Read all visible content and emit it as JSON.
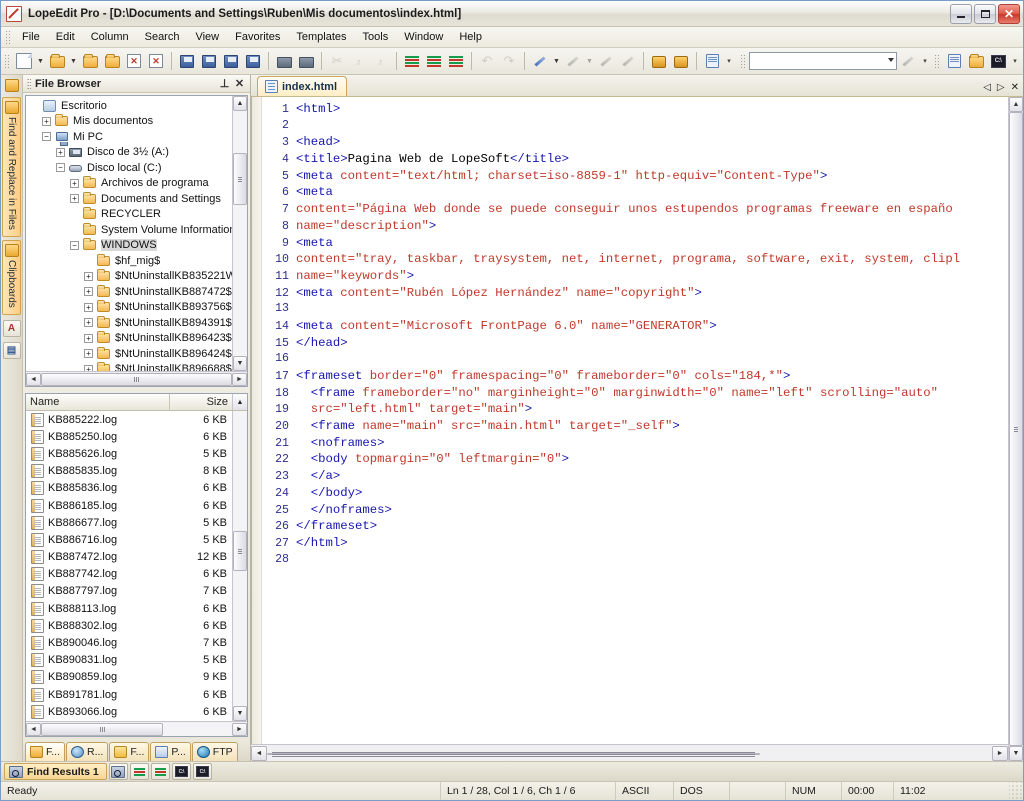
{
  "window": {
    "title": "LopeEdit Pro - [D:\\Documents and Settings\\Ruben\\Mis documentos\\index.html]",
    "minimize_label": "_",
    "maximize_label": "□",
    "close_label": "✕"
  },
  "menu": {
    "items": [
      "File",
      "Edit",
      "Column",
      "Search",
      "View",
      "Favorites",
      "Templates",
      "Tools",
      "Window",
      "Help"
    ]
  },
  "toolbar": {
    "search_value": "",
    "search_placeholder": "",
    "buttons": [
      "new-file",
      "new-file-dropdown",
      "open-file",
      "open-file-dropdown",
      "open-recent",
      "close-file",
      "close-all",
      "close-window",
      "save",
      "save-as",
      "save-all",
      "save-to-ftp",
      "print",
      "print-preview",
      "cut",
      "copy",
      "paste",
      "compare",
      "indent",
      "outdent",
      "undo",
      "redo",
      "highlight",
      "highlight-dropdown",
      "bookmark-toggle",
      "bookmark-next",
      "bookmark-clear",
      "macro-record",
      "macro-play",
      "run-external",
      "go-to",
      "favorites-folder",
      "console"
    ]
  },
  "rail": {
    "tabs": [
      {
        "label": "Find and Replace in Files",
        "icon": "folder-search-icon"
      },
      {
        "label": "Clipboards",
        "icon": "clipboard-icon"
      }
    ],
    "buttons": [
      "ascii-table-icon",
      "document-icon"
    ]
  },
  "file_browser": {
    "title": "File Browser",
    "pin_label": "⊥",
    "close_label": "✕",
    "tree": [
      {
        "label": "Escritorio",
        "indent": 0,
        "expander": "",
        "icon": "desktop-icon"
      },
      {
        "label": "Mis documentos",
        "indent": 1,
        "expander": "+",
        "icon": "folder-icon"
      },
      {
        "label": "Mi PC",
        "indent": 1,
        "expander": "−",
        "icon": "computer-icon"
      },
      {
        "label": "Disco de 3½ (A:)",
        "indent": 2,
        "expander": "+",
        "icon": "floppy-icon"
      },
      {
        "label": "Disco local (C:)",
        "indent": 2,
        "expander": "−",
        "icon": "harddisk-icon"
      },
      {
        "label": "Archivos de programa",
        "indent": 3,
        "expander": "+",
        "icon": "folder-icon"
      },
      {
        "label": "Documents and Settings",
        "indent": 3,
        "expander": "+",
        "icon": "folder-icon"
      },
      {
        "label": "RECYCLER",
        "indent": 3,
        "expander": "",
        "icon": "folder-icon"
      },
      {
        "label": "System Volume Information",
        "indent": 3,
        "expander": "",
        "icon": "folder-icon"
      },
      {
        "label": "WINDOWS",
        "indent": 3,
        "expander": "−",
        "icon": "folder-icon",
        "selected": true
      },
      {
        "label": "$hf_mig$",
        "indent": 4,
        "expander": "",
        "icon": "folder-icon"
      },
      {
        "label": "$NtUninstallKB835221W",
        "indent": 4,
        "expander": "+",
        "icon": "folder-icon"
      },
      {
        "label": "$NtUninstallKB887472$",
        "indent": 4,
        "expander": "+",
        "icon": "folder-icon"
      },
      {
        "label": "$NtUninstallKB893756$",
        "indent": 4,
        "expander": "+",
        "icon": "folder-icon"
      },
      {
        "label": "$NtUninstallKB894391$",
        "indent": 4,
        "expander": "+",
        "icon": "folder-icon"
      },
      {
        "label": "$NtUninstallKB896423$",
        "indent": 4,
        "expander": "+",
        "icon": "folder-icon"
      },
      {
        "label": "$NtUninstallKB896424$",
        "indent": 4,
        "expander": "+",
        "icon": "folder-icon"
      },
      {
        "label": "$NtUninstallKB896688$",
        "indent": 4,
        "expander": "+",
        "icon": "folder-icon"
      }
    ],
    "list_headers": {
      "name": "Name",
      "size": "Size"
    },
    "files": [
      {
        "name": "KB885222.log",
        "size": "6 KB"
      },
      {
        "name": "KB885250.log",
        "size": "6 KB"
      },
      {
        "name": "KB885626.log",
        "size": "5 KB"
      },
      {
        "name": "KB885835.log",
        "size": "8 KB"
      },
      {
        "name": "KB885836.log",
        "size": "6 KB"
      },
      {
        "name": "KB886185.log",
        "size": "6 KB"
      },
      {
        "name": "KB886677.log",
        "size": "5 KB"
      },
      {
        "name": "KB886716.log",
        "size": "5 KB"
      },
      {
        "name": "KB887472.log",
        "size": "12 KB"
      },
      {
        "name": "KB887742.log",
        "size": "6 KB"
      },
      {
        "name": "KB887797.log",
        "size": "7 KB"
      },
      {
        "name": "KB888113.log",
        "size": "6 KB"
      },
      {
        "name": "KB888302.log",
        "size": "6 KB"
      },
      {
        "name": "KB890046.log",
        "size": "7 KB"
      },
      {
        "name": "KB890831.log",
        "size": "5 KB"
      },
      {
        "name": "KB890859.log",
        "size": "9 KB"
      },
      {
        "name": "KB891781.log",
        "size": "6 KB"
      },
      {
        "name": "KB893066.log",
        "size": "6 KB"
      }
    ],
    "bottom_tabs": [
      {
        "label": "F...",
        "icon": "folder-icon",
        "active": true
      },
      {
        "label": "R...",
        "icon": "recent-icon",
        "active": false
      },
      {
        "label": "F...",
        "icon": "favorites-icon",
        "active": false
      },
      {
        "label": "P...",
        "icon": "project-icon",
        "active": false
      },
      {
        "label": "FTP",
        "icon": "ftp-globe-icon",
        "active": false
      }
    ]
  },
  "editor": {
    "tab": {
      "label": "index.html",
      "icon": "html-document-icon"
    },
    "tab_nav": {
      "prev": "◁",
      "next": "▷",
      "close": "✕"
    },
    "lines": [
      {
        "n": "1",
        "segments": [
          {
            "t": "<html>",
            "c": "tag"
          }
        ]
      },
      {
        "n": "2",
        "segments": []
      },
      {
        "n": "3",
        "segments": [
          {
            "t": "<head>",
            "c": "tag"
          }
        ]
      },
      {
        "n": "4",
        "segments": [
          {
            "t": "<title>",
            "c": "tag"
          },
          {
            "t": "Pagina Web de LopeSoft",
            "c": "txt"
          },
          {
            "t": "</title>",
            "c": "tag"
          }
        ]
      },
      {
        "n": "5",
        "segments": [
          {
            "t": "<meta ",
            "c": "tag"
          },
          {
            "t": "content=\"text/html; charset=iso-8859-1\" http-equiv=\"Content-Type\"",
            "c": "attr"
          },
          {
            "t": ">",
            "c": "tag"
          }
        ]
      },
      {
        "n": "6",
        "segments": [
          {
            "t": "<meta",
            "c": "tag"
          }
        ]
      },
      {
        "n": "7",
        "segments": [
          {
            "t": "content=\"Página Web donde se puede conseguir unos estupendos programas freeware en españo",
            "c": "attr"
          }
        ]
      },
      {
        "n": "8",
        "segments": [
          {
            "t": "name=\"description\"",
            "c": "attr"
          },
          {
            "t": ">",
            "c": "tag"
          }
        ]
      },
      {
        "n": "9",
        "segments": [
          {
            "t": "<meta",
            "c": "tag"
          }
        ]
      },
      {
        "n": "10",
        "segments": [
          {
            "t": "content=\"tray, taskbar, traysystem, net, internet, programa, software, exit, system, clipl",
            "c": "attr"
          }
        ]
      },
      {
        "n": "11",
        "segments": [
          {
            "t": "name=\"keywords\"",
            "c": "attr"
          },
          {
            "t": ">",
            "c": "tag"
          }
        ]
      },
      {
        "n": "12",
        "segments": [
          {
            "t": "<meta ",
            "c": "tag"
          },
          {
            "t": "content=\"Rubén López Hernández\" name=\"copyright\"",
            "c": "attr"
          },
          {
            "t": ">",
            "c": "tag"
          }
        ]
      },
      {
        "n": "13",
        "segments": []
      },
      {
        "n": "14",
        "segments": [
          {
            "t": "<meta ",
            "c": "tag"
          },
          {
            "t": "content=\"Microsoft FrontPage 6.0\" name=\"GENERATOR\"",
            "c": "attr"
          },
          {
            "t": ">",
            "c": "tag"
          }
        ]
      },
      {
        "n": "15",
        "segments": [
          {
            "t": "</head>",
            "c": "tag"
          }
        ]
      },
      {
        "n": "16",
        "segments": []
      },
      {
        "n": "17",
        "segments": [
          {
            "t": "<frameset ",
            "c": "tag"
          },
          {
            "t": "border=\"0\" framespacing=\"0\" frameborder=\"0\" cols=\"184,*\"",
            "c": "attr"
          },
          {
            "t": ">",
            "c": "tag"
          }
        ]
      },
      {
        "n": "18",
        "segments": [
          {
            "t": "  <frame ",
            "c": "tag"
          },
          {
            "t": "frameborder=\"no\" marginheight=\"0\" marginwidth=\"0\" name=\"left\" scrolling=\"auto\"",
            "c": "attr"
          }
        ]
      },
      {
        "n": "19",
        "segments": [
          {
            "t": "  ",
            "c": "txt"
          },
          {
            "t": "src=\"left.html\" target=\"main\"",
            "c": "attr"
          },
          {
            "t": ">",
            "c": "tag"
          }
        ]
      },
      {
        "n": "20",
        "segments": [
          {
            "t": "  <frame ",
            "c": "tag"
          },
          {
            "t": "name=\"main\" src=\"main.html\" target=\"_self\"",
            "c": "attr"
          },
          {
            "t": ">",
            "c": "tag"
          }
        ]
      },
      {
        "n": "21",
        "segments": [
          {
            "t": "  <noframes>",
            "c": "tag"
          }
        ]
      },
      {
        "n": "22",
        "segments": [
          {
            "t": "  <body ",
            "c": "tag"
          },
          {
            "t": "topmargin=\"0\" leftmargin=\"0\"",
            "c": "attr"
          },
          {
            "t": ">",
            "c": "tag"
          }
        ]
      },
      {
        "n": "23",
        "segments": [
          {
            "t": "  </a>",
            "c": "tag"
          }
        ]
      },
      {
        "n": "24",
        "segments": [
          {
            "t": "  </body>",
            "c": "tag"
          }
        ]
      },
      {
        "n": "25",
        "segments": [
          {
            "t": "  </noframes>",
            "c": "tag"
          }
        ]
      },
      {
        "n": "26",
        "segments": [
          {
            "t": "</frameset>",
            "c": "tag"
          }
        ]
      },
      {
        "n": "27",
        "segments": [
          {
            "t": "</html>",
            "c": "tag"
          }
        ]
      },
      {
        "n": "28",
        "segments": []
      }
    ]
  },
  "find_results": {
    "tab_label": "Find Results 1",
    "buttons": [
      "find-in-files-icon",
      "find-prev-icon",
      "find-next-icon",
      "console-1-icon",
      "console-2-icon"
    ]
  },
  "statusbar": {
    "message": "Ready",
    "position": "Ln 1 / 28, Col 1 / 6, Ch 1 / 6",
    "encoding": "ASCII",
    "line_ending": "DOS",
    "blank": "",
    "num_lock": "NUM",
    "elapsed": "00:00",
    "clock": "11:02"
  },
  "colors": {
    "accent": "#f7d590",
    "tag": "#1515b0",
    "attr": "#c0392b",
    "title_text": "#1b1b1b",
    "close_red": "#c4392c"
  }
}
